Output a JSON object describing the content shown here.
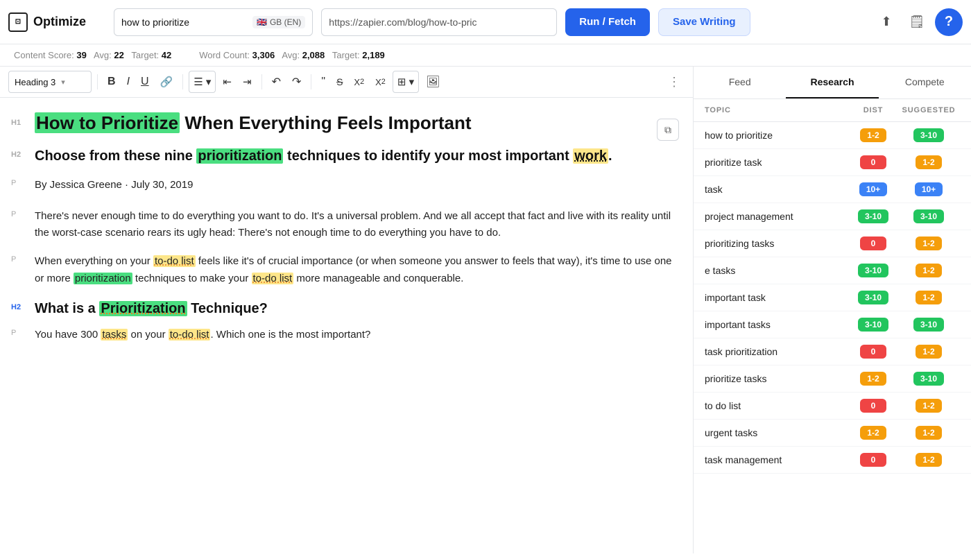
{
  "header": {
    "logo_icon": "□",
    "logo_text": "Optimize",
    "search_value": "how to prioritize",
    "lang_flag": "🇬🇧",
    "lang_code": "GB (EN)",
    "url_value": "https://zapier.com/blog/how-to-pric",
    "run_label": "Run / Fetch",
    "save_label": "Save Writing",
    "help_label": "?"
  },
  "stats_bar": {
    "content_score_label": "Content Score:",
    "content_score": "39",
    "content_avg_label": "Avg:",
    "content_avg": "22",
    "content_target_label": "Target:",
    "content_target": "42",
    "word_count_label": "Word Count:",
    "word_count": "3,306",
    "word_avg_label": "Avg:",
    "word_avg": "2,088",
    "word_target_label": "Target:",
    "word_target": "2,189"
  },
  "toolbar": {
    "heading_label": "Heading 3",
    "chevron": "▾"
  },
  "editor": {
    "h1_marker": "H1",
    "h1_text_plain": "How to Prioritize When Everything Feels Important",
    "h2_marker_1": "H2",
    "h2_text_1": "Choose from these nine prioritization techniques to identify your most important work.",
    "p_marker_1": "P",
    "p_text_1": "By Jessica Greene · July 30, 2019",
    "p_marker_2": "P",
    "p_text_2": "There's never enough time to do everything you want to do. It's a universal problem. And we all accept that fact and live with its reality until the worst-case scenario rears its ugly head: There's not enough time to do everything you have to do.",
    "p_marker_3": "P",
    "p_text_3a": "When everything on your ",
    "p_hl_3a": "to-do list",
    "p_text_3b": " feels like it's of crucial importance (or when someone you answer to feels that way), it's time to use one or more ",
    "p_hl_3b": "prioritization",
    "p_text_3c": " techniques to make your ",
    "p_hl_3c": "to-do list",
    "p_text_3d": " more manageable and conquerable.",
    "h2_marker_2": "H2",
    "h2_text_2a": "What is a ",
    "h2_hl_2": "Prioritization",
    "h2_text_2b": " Technique?",
    "p_marker_4": "P",
    "p_text_4": "You have 300 tasks on your to-do list. Which one is the most important?"
  },
  "right_panel": {
    "tabs": [
      {
        "id": "feed",
        "label": "Feed",
        "active": false
      },
      {
        "id": "research",
        "label": "Research",
        "active": true
      },
      {
        "id": "compete",
        "label": "Compete",
        "active": false
      }
    ],
    "table_headers": {
      "topic": "TOPIC",
      "dist": "DIST",
      "suggested": "SUGGESTED"
    },
    "topics": [
      {
        "name": "how to prioritize",
        "dist": "1-2",
        "dist_color": "orange",
        "suggested": "3-10",
        "suggested_color": "green"
      },
      {
        "name": "prioritize task",
        "dist": "0",
        "dist_color": "red",
        "suggested": "1-2",
        "suggested_color": "orange"
      },
      {
        "name": "task",
        "dist": "10+",
        "dist_color": "blue",
        "suggested": "10+",
        "suggested_color": "blue"
      },
      {
        "name": "project management",
        "dist": "3-10",
        "dist_color": "green",
        "suggested": "3-10",
        "suggested_color": "green"
      },
      {
        "name": "prioritizing tasks",
        "dist": "0",
        "dist_color": "red",
        "suggested": "1-2",
        "suggested_color": "orange"
      },
      {
        "name": "e tasks",
        "dist": "3-10",
        "dist_color": "green",
        "suggested": "1-2",
        "suggested_color": "orange"
      },
      {
        "name": "important task",
        "dist": "3-10",
        "dist_color": "green",
        "suggested": "1-2",
        "suggested_color": "orange"
      },
      {
        "name": "important tasks",
        "dist": "3-10",
        "dist_color": "green",
        "suggested": "3-10",
        "suggested_color": "green"
      },
      {
        "name": "task prioritization",
        "dist": "0",
        "dist_color": "red",
        "suggested": "1-2",
        "suggested_color": "orange"
      },
      {
        "name": "prioritize tasks",
        "dist": "1-2",
        "dist_color": "orange",
        "suggested": "3-10",
        "suggested_color": "green"
      },
      {
        "name": "to do list",
        "dist": "0",
        "dist_color": "red",
        "suggested": "1-2",
        "suggested_color": "orange"
      },
      {
        "name": "urgent tasks",
        "dist": "1-2",
        "dist_color": "orange",
        "suggested": "1-2",
        "suggested_color": "orange"
      },
      {
        "name": "task management",
        "dist": "0",
        "dist_color": "red",
        "suggested": "1-2",
        "suggested_color": "orange"
      }
    ]
  }
}
